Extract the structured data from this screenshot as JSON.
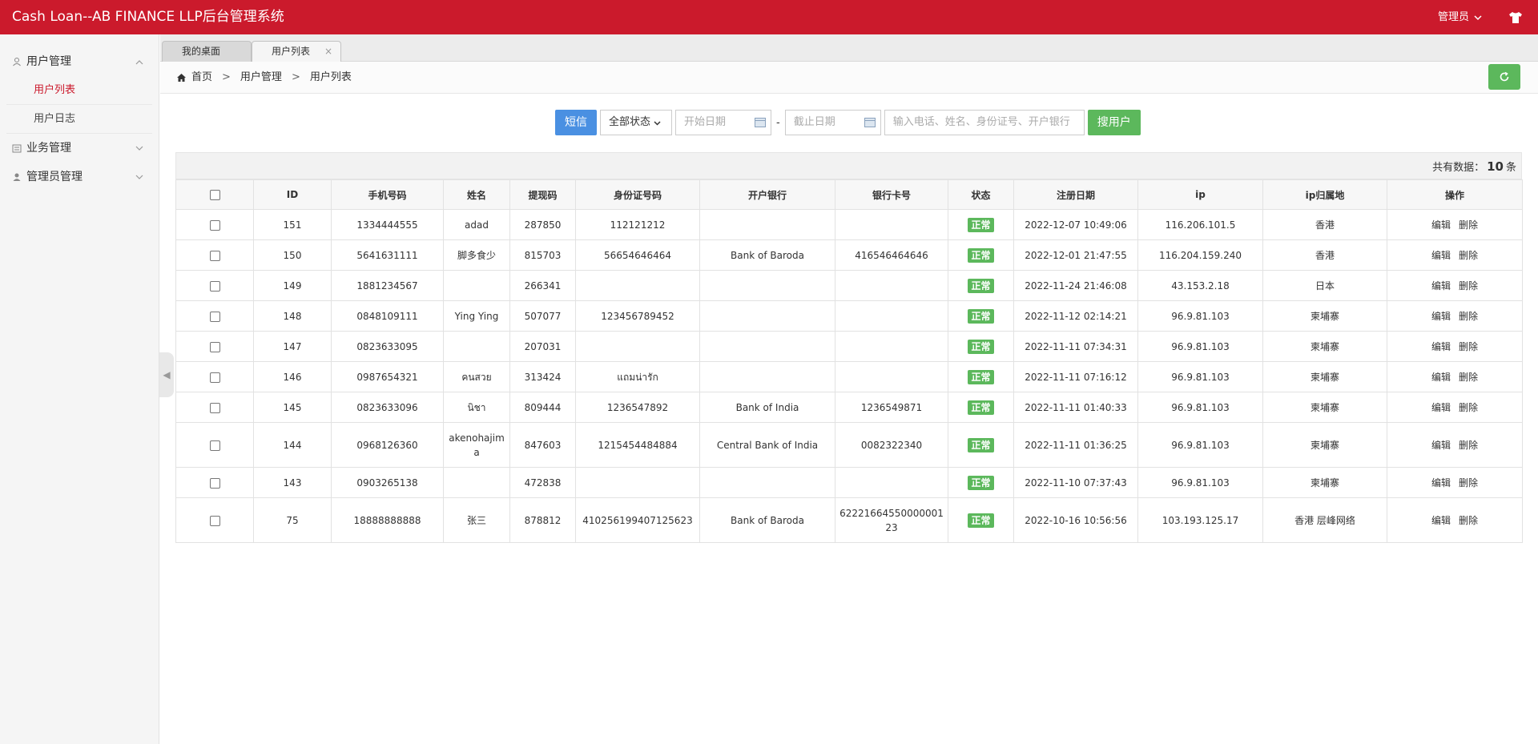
{
  "header": {
    "title": "Cash Loan--AB FINANCE LLP后台管理系统",
    "admin_label": "管理员"
  },
  "sidebar": {
    "groups": [
      {
        "label": "用户管理",
        "items": [
          {
            "label": "用户列表",
            "active": true
          },
          {
            "label": "用户日志",
            "active": false
          }
        ]
      },
      {
        "label": "业务管理"
      },
      {
        "label": "管理员管理"
      }
    ]
  },
  "tabs": [
    {
      "label": "我的桌面"
    },
    {
      "label": "用户列表",
      "close": "×"
    }
  ],
  "breadcrumb": {
    "home": "首页",
    "sep1": ">",
    "level1": "用户管理",
    "sep2": ">",
    "level2": "用户列表"
  },
  "toolbar": {
    "sms_label": "短信",
    "status_select": "全部状态",
    "start_date_placeholder": "开始日期",
    "date_sep": "-",
    "end_date_placeholder": "截止日期",
    "search_placeholder": "输入电话、姓名、身份证号、开户银行",
    "search_button": "搜用户"
  },
  "summary": {
    "prefix": "共有数据：",
    "count": "10",
    "suffix": "条"
  },
  "table": {
    "columns": [
      "ID",
      "手机号码",
      "姓名",
      "提现码",
      "身份证号码",
      "开户银行",
      "银行卡号",
      "状态",
      "注册日期",
      "ip",
      "ip归属地",
      "操作"
    ],
    "rows": [
      [
        "151",
        "1334444555",
        "adad",
        "287850",
        "112121212",
        "",
        "",
        "正常",
        "2022-12-07 10:49:06",
        "116.206.101.5",
        "香港"
      ],
      [
        "150",
        "5641631111",
        "脚多食少",
        "815703",
        "56654646464",
        "Bank of Baroda",
        "416546464646",
        "正常",
        "2022-12-01 21:47:55",
        "116.204.159.240",
        "香港"
      ],
      [
        "149",
        "1881234567",
        "",
        "266341",
        "",
        "",
        "",
        "正常",
        "2022-11-24 21:46:08",
        "43.153.2.18",
        "日本"
      ],
      [
        "148",
        "0848109111",
        "Ying Ying",
        "507077",
        "123456789452",
        "",
        "",
        "正常",
        "2022-11-12 02:14:21",
        "96.9.81.103",
        "柬埔寨"
      ],
      [
        "147",
        "0823633095",
        "",
        "207031",
        "",
        "",
        "",
        "正常",
        "2022-11-11 07:34:31",
        "96.9.81.103",
        "柬埔寨"
      ],
      [
        "146",
        "0987654321",
        "คนสวย",
        "313424",
        "แถมน่ารัก",
        "",
        "",
        "正常",
        "2022-11-11 07:16:12",
        "96.9.81.103",
        "柬埔寨"
      ],
      [
        "145",
        "0823633096",
        "นิชา",
        "809444",
        "1236547892",
        "Bank of India",
        "1236549871",
        "正常",
        "2022-11-11 01:40:33",
        "96.9.81.103",
        "柬埔寨"
      ],
      [
        "144",
        "0968126360",
        "akenohajima",
        "847603",
        "1215454484884",
        "Central Bank of India",
        "0082322340",
        "正常",
        "2022-11-11 01:36:25",
        "96.9.81.103",
        "柬埔寨"
      ],
      [
        "143",
        "0903265138",
        "",
        "472838",
        "",
        "",
        "",
        "正常",
        "2022-11-10 07:37:43",
        "96.9.81.103",
        "柬埔寨"
      ],
      [
        "75",
        "18888888888",
        "张三",
        "878812",
        "410256199407125623",
        "Bank of Baroda",
        "6222166455000000123",
        "正常",
        "2022-10-16 10:56:56",
        "103.193.125.17",
        "香港 层峰网络"
      ]
    ],
    "actions": {
      "edit": "编辑",
      "delete": "删除"
    }
  },
  "colors": {
    "brand_red": "#cb1a2c",
    "status_green": "#5cb85c",
    "sms_blue": "#4a90e2"
  }
}
